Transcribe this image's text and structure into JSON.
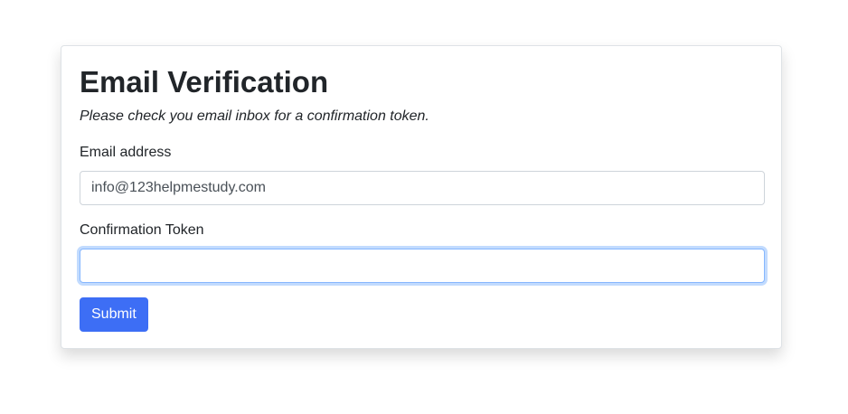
{
  "form": {
    "title": "Email Verification",
    "subtitle": "Please check you email inbox for a confirmation token.",
    "email_label": "Email address",
    "email_value": "info@123helpmestudy.com",
    "token_label": "Confirmation Token",
    "token_value": "",
    "submit_label": "Submit"
  },
  "colors": {
    "primary": "#3d6ef5",
    "focus_border": "#86b7fe",
    "text": "#212529"
  }
}
